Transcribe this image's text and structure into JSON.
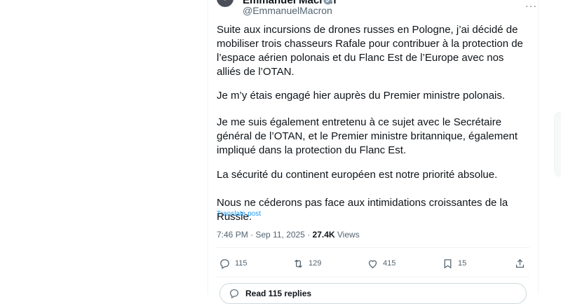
{
  "tweet": {
    "display_name": "Emmanuel Macron",
    "handle": "@EmmanuelMacron",
    "paragraphs": [
      "Suite aux incursions de drones russes en Pologne, j’ai décidé de mobiliser trois chasseurs Rafale pour contribuer à la protection de l’espace aérien polonais et du Flanc Est de l’Europe avec nos alliés de l’OTAN.",
      "Je m’y étais engagé hier auprès du Premier ministre polonais.",
      "Je me suis également entretenu à ce sujet avec le Secrétaire général de l’OTAN, et le Premier ministre britannique, également impliqué dans la protection du Flanc Est.",
      "La sécurité du continent européen est notre priorité absolue.",
      "Nous ne céderons pas face aux intimidations croissantes de la Russie."
    ],
    "translate_label": "Translate post",
    "timestamp": "7:46 PM · Sep 11, 2025 · ",
    "views_count": "27.4K",
    "views_label": " Views"
  },
  "actions": {
    "replies": "115",
    "reposts": "129",
    "likes": "415",
    "bookmarks": "15"
  },
  "read_replies_label": "Read 115 replies",
  "colors": {
    "accent": "#1d9bf0",
    "text": "#0f1419",
    "muted": "#536471",
    "border": "#eff3f4"
  },
  "icons": [
    "verified-badge-icon",
    "more-icon",
    "reply-icon",
    "repost-icon",
    "like-icon",
    "bookmark-icon",
    "share-icon",
    "reply-bubble-icon"
  ]
}
